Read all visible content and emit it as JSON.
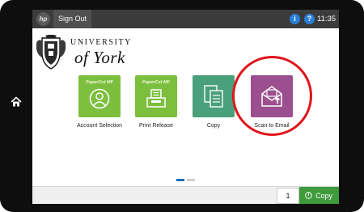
{
  "topbar": {
    "brand_icon": "hp-logo-icon",
    "brand_text": "hp",
    "signout_label": "Sign Out",
    "info_symbol": "i",
    "help_symbol": "?",
    "time": "11:35",
    "bar_color": "#3b3b3b"
  },
  "logo": {
    "line1": "UNIVERSITY",
    "line2": "of York"
  },
  "apps": [
    {
      "brand": "PaperCut MF",
      "label": "Account Selection",
      "icon": "account-person-icon",
      "color": "#7cbf3e"
    },
    {
      "brand": "PaperCut MF",
      "label": "Print Release",
      "icon": "print-release-icon",
      "color": "#7cbf3e"
    },
    {
      "brand": "",
      "label": "Copy",
      "icon": "copy-documents-icon",
      "color": "#4aa07a"
    },
    {
      "brand": "",
      "label": "Scan to Email",
      "icon": "email-envelope-icon",
      "color": "#9c4f8e"
    }
  ],
  "highlight": {
    "target": "Scan to Email",
    "color": "#e0141b"
  },
  "pager": {
    "current_page": 1,
    "total_pages": 2
  },
  "bottombar": {
    "copies_value": "1",
    "copy_button_label": "Copy",
    "copy_button_color": "#3f9a3b"
  }
}
